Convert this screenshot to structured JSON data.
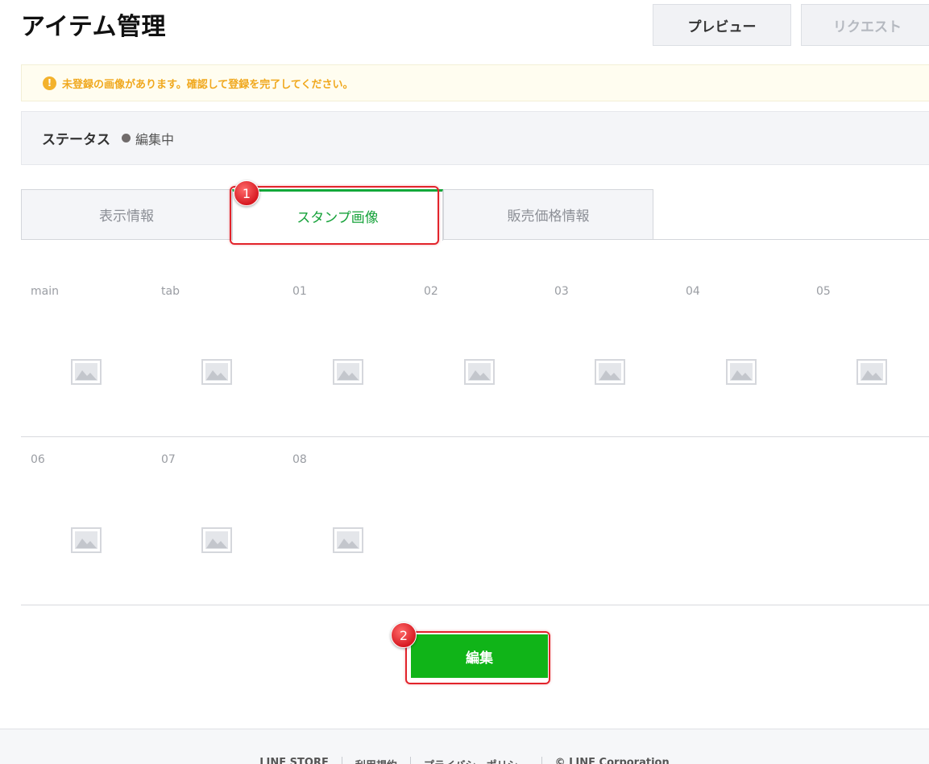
{
  "header": {
    "title": "アイテム管理",
    "preview_label": "プレビュー",
    "request_label": "リクエスト"
  },
  "notice": {
    "icon": "warning-icon",
    "icon_glyph": "!",
    "text": "未登録の画像があります。確認して登録を完了してください。"
  },
  "status": {
    "label": "ステータス",
    "value": "編集中"
  },
  "tabs": [
    {
      "label": "表示情報",
      "active": false
    },
    {
      "label": "スタンプ画像",
      "active": true
    },
    {
      "label": "販売価格情報",
      "active": false
    }
  ],
  "images": {
    "row1": [
      "main",
      "tab",
      "01",
      "02",
      "03",
      "04",
      "05"
    ],
    "row2": [
      "06",
      "07",
      "08"
    ],
    "placeholder_icon": "image-placeholder-icon"
  },
  "actions": {
    "edit_label": "編集"
  },
  "annotations": {
    "badge1": "1",
    "badge2": "2"
  },
  "footer": {
    "links": [
      "LINE STORE",
      "利用規約",
      "プライバシーポリシー",
      "© LINE Corporation"
    ]
  },
  "colors": {
    "accent_green": "#10b418",
    "tab_active_text": "#16a23a",
    "warning": "#f0a81d",
    "annotation_red": "#e2232b"
  }
}
